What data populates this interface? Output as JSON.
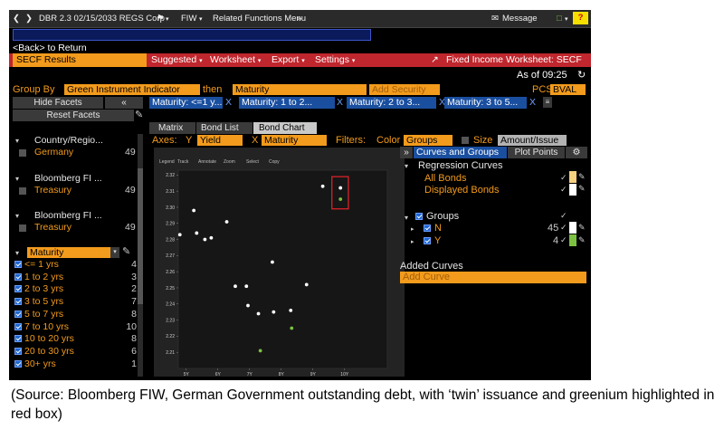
{
  "topbar": {
    "security": "DBR 2.3 02/15/2033 REGS Corp",
    "function": "FIW",
    "related": "Related Functions Menu",
    "message": "Message",
    "help": "?"
  },
  "back_link": "<Back> to Return",
  "title_bar": {
    "results": "SECF Results",
    "suggested": "Suggested",
    "worksheet": "Worksheet",
    "export": "Export",
    "settings": "Settings",
    "fixed_income": "Fixed Income Worksheet: SECF"
  },
  "as_of": "As of 09:25",
  "group_by": {
    "label": "Group By",
    "field1": "Green Instrument Indicator",
    "then": "then",
    "field2": "Maturity",
    "add_security": "Add Security",
    "pcs_label": "PCS",
    "pcs_value": "BVAL"
  },
  "facet_buttons": {
    "hide": "Hide Facets",
    "collapse": "«",
    "reset": "Reset Facets"
  },
  "filter_chips": [
    {
      "label": "Maturity: <=1 y...",
      "x": "X"
    },
    {
      "label": "Maturity: 1 to 2...",
      "x": "X"
    },
    {
      "label": "Maturity: 2 to 3...",
      "x": "X"
    },
    {
      "label": "Maturity: 3 to 5...",
      "x": "X"
    }
  ],
  "sidebar": {
    "facets": [
      {
        "header": "Country/Regio...",
        "value": "Germany",
        "count": "49"
      },
      {
        "header": "Bloomberg FI ...",
        "value": "Treasury",
        "count": "49"
      },
      {
        "header": "Bloomberg FI ...",
        "value": "Treasury",
        "count": "49"
      }
    ],
    "maturity_header": "Maturity",
    "maturity_items": [
      {
        "label": "<= 1 yrs",
        "count": "4"
      },
      {
        "label": "1 to 2 yrs",
        "count": "3"
      },
      {
        "label": "2 to 3 yrs",
        "count": "2"
      },
      {
        "label": "3 to 5 yrs",
        "count": "7"
      },
      {
        "label": "5 to 7 yrs",
        "count": "8"
      },
      {
        "label": "7 to 10 yrs",
        "count": "10"
      },
      {
        "label": "10 to 20 yrs",
        "count": "8"
      },
      {
        "label": "20 to 30 yrs",
        "count": "6"
      },
      {
        "label": "30+ yrs",
        "count": "1"
      }
    ]
  },
  "view_tabs": [
    "Matrix",
    "Bond List",
    "Bond Chart"
  ],
  "axes": {
    "label": "Axes:",
    "y_label": "Y",
    "y_value": "Yield",
    "x_label": "X",
    "x_value": "Maturity",
    "filters": "Filters:",
    "color_label": "Color",
    "color_value": "Groups",
    "size_label": "Size",
    "size_value": "Amount/Issue"
  },
  "plot_toolbar": [
    "Legend",
    "Track",
    "Annotate",
    "Zoom",
    "Select",
    "Copy"
  ],
  "right_panel": {
    "collapse": "»",
    "tab_curves": "Curves and Groups",
    "tab_points": "Plot Points",
    "regression_header": "Regression Curves",
    "all_bonds": "All Bonds",
    "displayed_bonds": "Displayed Bonds",
    "groups_header": "Groups",
    "groups": [
      {
        "name": "N",
        "count": "45",
        "color": "#ffffff"
      },
      {
        "name": "Y",
        "count": "4",
        "color": "#7cc242"
      }
    ],
    "added_curves": "Added Curves",
    "add_curve": "Add Curve"
  },
  "chart_data": {
    "type": "scatter",
    "xlabel": "Maturity",
    "ylabel": "",
    "x_ticks": [
      "5Y",
      "6Y",
      "7Y",
      "8Y",
      "9Y",
      "10Y"
    ],
    "y_ticks": [
      "2.21",
      "2.22",
      "2.23",
      "2.24",
      "2.25",
      "2.26",
      "2.27",
      "2.28",
      "2.29",
      "2.30",
      "2.31",
      "2.32"
    ],
    "xlim": [
      4.75,
      11.35
    ],
    "ylim": [
      2.2,
      2.323
    ],
    "series": [
      {
        "name": "N",
        "color": "#ffffff",
        "points": [
          [
            4.8,
            2.283
          ],
          [
            5.24,
            2.298
          ],
          [
            5.33,
            2.284
          ],
          [
            5.59,
            2.28
          ],
          [
            5.79,
            2.281
          ],
          [
            6.28,
            2.291
          ],
          [
            6.55,
            2.251
          ],
          [
            6.9,
            2.251
          ],
          [
            6.95,
            2.239
          ],
          [
            7.28,
            2.234
          ],
          [
            7.72,
            2.266
          ],
          [
            7.76,
            2.235
          ],
          [
            8.3,
            2.236
          ],
          [
            8.8,
            2.252
          ],
          [
            9.31,
            2.313
          ],
          [
            9.87,
            2.312
          ]
        ]
      },
      {
        "name": "Y",
        "color": "#7cc242",
        "points": [
          [
            7.34,
            2.211
          ],
          [
            8.33,
            2.225
          ],
          [
            9.87,
            2.305
          ]
        ]
      }
    ],
    "highlight": {
      "x": [
        9.6,
        10.12
      ],
      "y": [
        2.299,
        2.319
      ],
      "color": "#e8222a"
    }
  },
  "caption": "(Source: Bloomberg FIW, German Government outstanding debt, with ‘twin’ issuance and greenium highlighted in red box)"
}
